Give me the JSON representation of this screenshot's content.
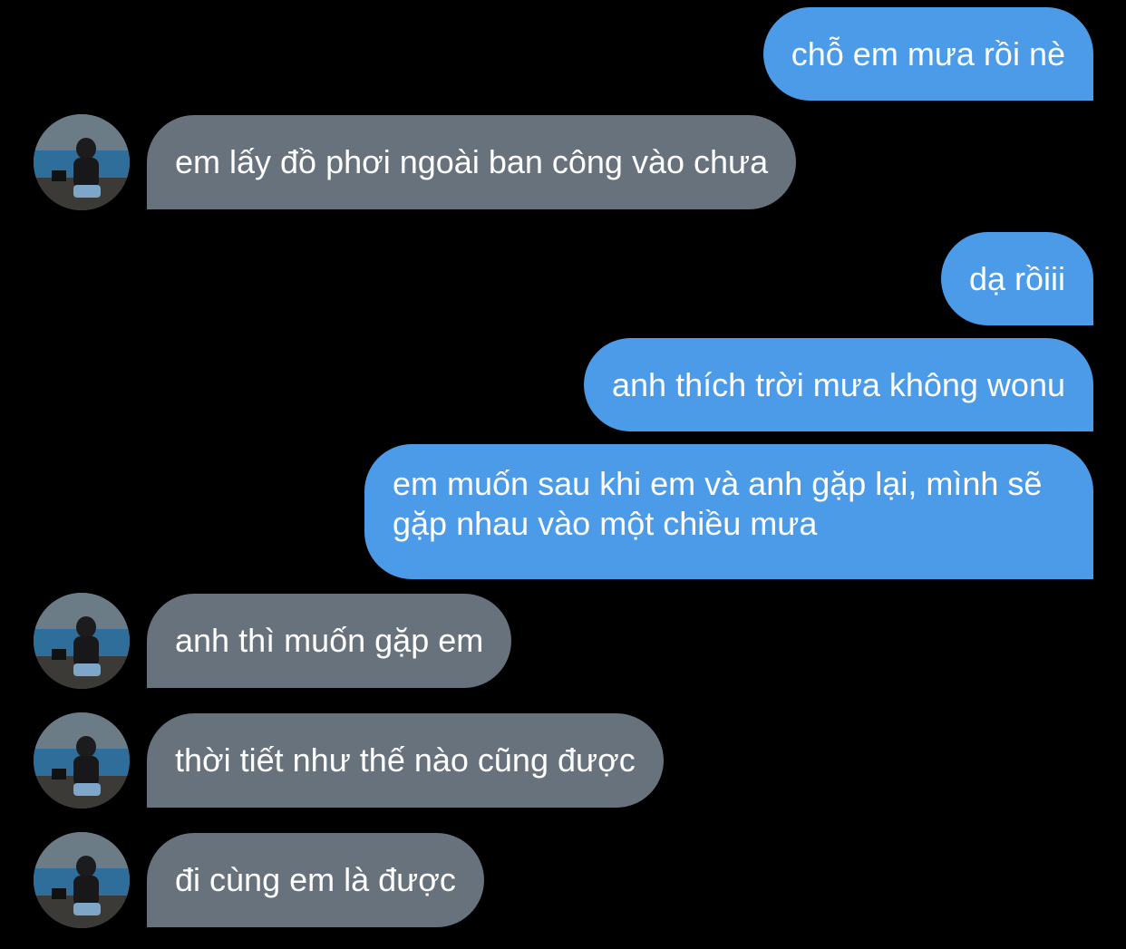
{
  "colors": {
    "background": "#000000",
    "sent_bubble": "#4b9be8",
    "received_bubble": "#67727d",
    "text": "#ffffff"
  },
  "avatar": {
    "icon": "profile-photo-icon"
  },
  "messages": [
    {
      "side": "sent",
      "text": "chỗ em mưa rồi nè"
    },
    {
      "side": "received",
      "text": "em lấy đồ phơi ngoài ban công vào chưa"
    },
    {
      "side": "sent",
      "text": "dạ rồiii"
    },
    {
      "side": "sent",
      "text": "anh thích trời mưa không wonu"
    },
    {
      "side": "sent",
      "text": "em muốn sau khi em và anh gặp lại, mình sẽ gặp nhau vào một chiều mưa"
    },
    {
      "side": "received",
      "text": "anh thì muốn gặp em"
    },
    {
      "side": "received",
      "text": "thời tiết như thế nào cũng được"
    },
    {
      "side": "received",
      "text": "đi cùng em là được"
    }
  ]
}
